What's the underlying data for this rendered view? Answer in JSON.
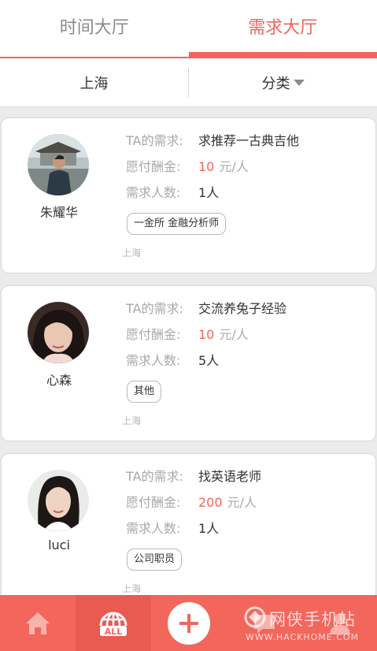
{
  "tabs": [
    {
      "label": "时间大厅",
      "active": false
    },
    {
      "label": "需求大厅",
      "active": true
    }
  ],
  "filter": {
    "city": "上海",
    "category": "分类"
  },
  "cards": [
    {
      "name": "朱耀华",
      "labels": {
        "need": "TA的需求:",
        "reward": "愿付酬金:",
        "people": "需求人数:"
      },
      "need": "求推荐一古典吉他",
      "reward_amount": "10",
      "reward_unit": "元/人",
      "people": "1人",
      "tag": "一金所 金融分析师",
      "location": "上海"
    },
    {
      "name": "心森",
      "labels": {
        "need": "TA的需求:",
        "reward": "愿付酬金:",
        "people": "需求人数:"
      },
      "need": "交流养兔子经验",
      "reward_amount": "10",
      "reward_unit": "元/人",
      "people": "5人",
      "tag": "其他",
      "location": "上海"
    },
    {
      "name": "luci",
      "labels": {
        "need": "TA的需求:",
        "reward": "愿付酬金:",
        "people": "需求人数:"
      },
      "need": "找英语老师",
      "reward_amount": "200",
      "reward_unit": "元/人",
      "people": "1人",
      "tag": "公司职员",
      "location": "上海"
    }
  ],
  "bottom_nav": {
    "items": [
      {
        "icon": "home-icon"
      },
      {
        "icon": "all-globe-icon",
        "text": "ALL"
      },
      {
        "icon": "plus-icon"
      },
      {
        "icon": "message-icon"
      },
      {
        "icon": "profile-icon"
      }
    ]
  },
  "watermark": {
    "title": "网侠手机站",
    "url": "WWW.HACKHOME.COM"
  },
  "colors": {
    "accent": "#f2655a",
    "bottom_bar": "#f3665c",
    "background": "#ebebeb"
  }
}
